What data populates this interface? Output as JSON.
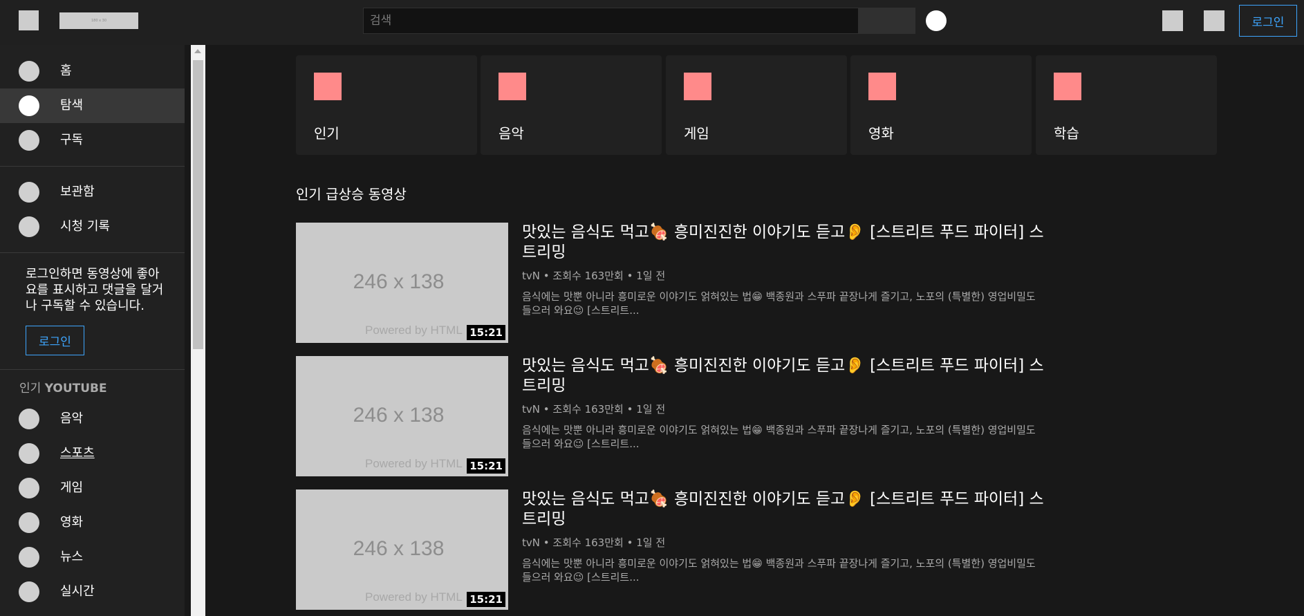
{
  "header": {
    "logo_text": "180 x 30",
    "search_placeholder": "검색",
    "login_label": "로그인"
  },
  "sidebar": {
    "main_items": [
      {
        "label": "홈",
        "active": false
      },
      {
        "label": "탐색",
        "active": true
      },
      {
        "label": "구독",
        "active": false
      }
    ],
    "library_items": [
      {
        "label": "보관함"
      },
      {
        "label": "시청 기록"
      }
    ],
    "login_promo_text": "로그인하면 동영상에 좋아요를 표시하고 댓글을 달거나 구독할 수 있습니다.",
    "login_promo_button": "로그인",
    "section_title_prefix": "인기",
    "section_title_brand": "YOUTUBE",
    "popular_items": [
      {
        "label": "음악"
      },
      {
        "label": "스포츠"
      },
      {
        "label": "게임"
      },
      {
        "label": "영화"
      },
      {
        "label": "뉴스"
      },
      {
        "label": "실시간"
      }
    ]
  },
  "categories": [
    {
      "label": "인기"
    },
    {
      "label": "음악"
    },
    {
      "label": "게임"
    },
    {
      "label": "영화"
    },
    {
      "label": "학습"
    }
  ],
  "section_heading": "인기 급상승 동영상",
  "videos": [
    {
      "thumb_size": "246 x 138",
      "thumb_powered": "Powered by HTML",
      "duration": "15:21",
      "title": "맛있는 음식도 먹고🍖 흥미진진한 이야기도 듣고👂 [스트리트 푸드 파이터] 스트리밍",
      "channel": "tvN",
      "views": "조회수 163만회",
      "age": "1일 전",
      "description": "음식에는 맛뿐 아니라 흥미로운 이야기도 얽혀있는 법😁 백종원과 스푸파 끝장나게 즐기고, 노포의 (특별한) 영업비밀도 들으러 와요😉 [스트리트..."
    },
    {
      "thumb_size": "246 x 138",
      "thumb_powered": "Powered by HTML",
      "duration": "15:21",
      "title": "맛있는 음식도 먹고🍖 흥미진진한 이야기도 듣고👂 [스트리트 푸드 파이터] 스트리밍",
      "channel": "tvN",
      "views": "조회수 163만회",
      "age": "1일 전",
      "description": "음식에는 맛뿐 아니라 흥미로운 이야기도 얽혀있는 법😁 백종원과 스푸파 끝장나게 즐기고, 노포의 (특별한) 영업비밀도 들으러 와요😉 [스트리트..."
    },
    {
      "thumb_size": "246 x 138",
      "thumb_powered": "Powered by HTML",
      "duration": "15:21",
      "title": "맛있는 음식도 먹고🍖 흥미진진한 이야기도 듣고👂 [스트리트 푸드 파이터] 스트리밍",
      "channel": "tvN",
      "views": "조회수 163만회",
      "age": "1일 전",
      "description": "음식에는 맛뿐 아니라 흥미로운 이야기도 얽혀있는 법😁 백종원과 스푸파 끝장나게 즐기고, 노포의 (특별한) 영업비밀도 들으러 와요😉 [스트리트..."
    }
  ],
  "colors": {
    "background": "#181818",
    "surface": "#212121",
    "accent": "#3ea6ff",
    "category_icon": "#ff8a8a"
  }
}
